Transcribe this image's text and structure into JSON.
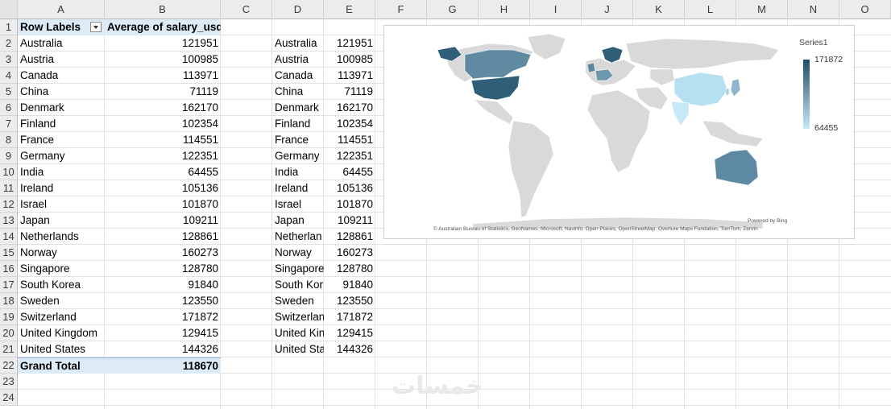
{
  "columns": [
    "A",
    "B",
    "C",
    "D",
    "E",
    "F",
    "G",
    "H",
    "I",
    "J",
    "K",
    "L",
    "M",
    "N",
    "O"
  ],
  "rows": [
    "1",
    "2",
    "3",
    "4",
    "5",
    "6",
    "7",
    "8",
    "9",
    "10",
    "11",
    "12",
    "13",
    "14",
    "15",
    "16",
    "17",
    "18",
    "19",
    "20",
    "21",
    "22",
    "23",
    "24"
  ],
  "pivot": {
    "header_label": "Row Labels",
    "header_value": "Average of salary_usd",
    "items": [
      {
        "country": "Australia",
        "value": "121951"
      },
      {
        "country": "Austria",
        "value": "100985"
      },
      {
        "country": "Canada",
        "value": "113971"
      },
      {
        "country": "China",
        "value": "71119"
      },
      {
        "country": "Denmark",
        "value": "162170"
      },
      {
        "country": "Finland",
        "value": "102354"
      },
      {
        "country": "France",
        "value": "114551"
      },
      {
        "country": "Germany",
        "value": "122351"
      },
      {
        "country": "India",
        "value": "64455"
      },
      {
        "country": "Ireland",
        "value": "105136"
      },
      {
        "country": "Israel",
        "value": "101870"
      },
      {
        "country": "Japan",
        "value": "109211"
      },
      {
        "country": "Netherlands",
        "value": "128861"
      },
      {
        "country": "Norway",
        "value": "160273"
      },
      {
        "country": "Singapore",
        "value": "128780"
      },
      {
        "country": "South Korea",
        "value": "91840"
      },
      {
        "country": "Sweden",
        "value": "123550"
      },
      {
        "country": "Switzerland",
        "value": "171872"
      },
      {
        "country": "United Kingdom",
        "value": "129415"
      },
      {
        "country": "United States",
        "value": "144326"
      }
    ],
    "total_label": "Grand Total",
    "total_value": "118670"
  },
  "copy_items": [
    {
      "country": "Australia",
      "value": "121951"
    },
    {
      "country": "Austria",
      "value": "100985"
    },
    {
      "country": "Canada",
      "value": "113971"
    },
    {
      "country": "China",
      "value": "71119"
    },
    {
      "country": "Denmark",
      "value": "162170"
    },
    {
      "country": "Finland",
      "value": "102354"
    },
    {
      "country": "France",
      "value": "114551"
    },
    {
      "country": "Germany",
      "value": "122351"
    },
    {
      "country": "India",
      "value": "64455"
    },
    {
      "country": "Ireland",
      "value": "105136"
    },
    {
      "country": "Israel",
      "value": "101870"
    },
    {
      "country": "Japan",
      "value": "109211"
    },
    {
      "country": "Netherlan",
      "value": "128861"
    },
    {
      "country": "Norway",
      "value": "160273"
    },
    {
      "country": "Singapore",
      "value": "128780"
    },
    {
      "country": "South Kor",
      "value": "91840"
    },
    {
      "country": "Sweden",
      "value": "123550"
    },
    {
      "country": "Switzerlan",
      "value": "171872"
    },
    {
      "country": "United Kin",
      "value": "129415"
    },
    {
      "country": "United Sta",
      "value": "144326"
    }
  ],
  "map_chart": {
    "legend_title": "Series1",
    "legend_max": "171872",
    "legend_min": "64455",
    "powered_by": "Powered by Bing",
    "attribution": "© Australian Bureau of Statistics, GeoNames, Microsoft, Navinfo, Open Places, OpenStreetMap, Overture Maps Fundation, TomTom, Zenrin",
    "colors": {
      "high": "#1f4e64",
      "low": "#c8e8f7",
      "land": "#d9d9d9"
    }
  },
  "watermark": "خمسات"
}
